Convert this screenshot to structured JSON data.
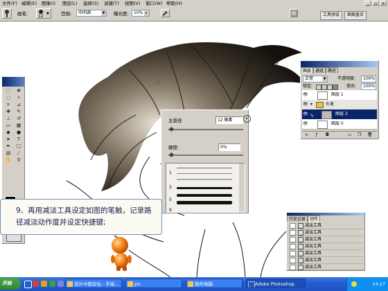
{
  "menubar": {
    "items": [
      "文件(F)",
      "编辑(E)",
      "图像(I)",
      "图层(L)",
      "选择(S)",
      "滤镜(T)",
      "视图(V)",
      "窗口(W)",
      "帮助(H)"
    ],
    "window_controls": [
      "_",
      "▫",
      "×"
    ]
  },
  "options": {
    "brush_label": "画笔:",
    "brush_size": "12",
    "range_label": "范围:",
    "range_value": "中间调",
    "exposure_label": "曝光度:",
    "exposure_value": "10%",
    "right_tabs": [
      "工具预设",
      "图案盖合"
    ]
  },
  "layers_panel": {
    "tabs": [
      "图层",
      "通道",
      "路径"
    ],
    "blend_mode": "正常",
    "opacity_label": "不透明度:",
    "opacity_value": "100%",
    "lock_label": "锁定:",
    "fill_label": "填充:",
    "fill_value": "100%",
    "layers": [
      {
        "name": "图层 1"
      },
      {
        "name": "头发"
      },
      {
        "name": "图层 3"
      },
      {
        "name": "图层 0"
      }
    ]
  },
  "brush_panel": {
    "diameter_label": "主直径",
    "diameter_value": "12 像素",
    "hardness_label": "硬度:",
    "hardness_value": "0%",
    "preset_numbers": [
      "1",
      "3",
      "5",
      "9"
    ]
  },
  "history_panel": {
    "tabs": [
      "历史记录",
      "动作"
    ],
    "items": [
      "减淡工具",
      "减淡工具",
      "减淡工具",
      "减淡工具",
      "减淡工具",
      "减淡工具",
      "减淡工具"
    ]
  },
  "callout": {
    "text": "9、再用减淡工具设定如图的笔触，记录路径减淡动作度并设定快捷键;"
  },
  "taskbar": {
    "start_label": "开始",
    "tasks": [
      {
        "label": "设计中国论坛 - 手绘..."
      },
      {
        "label": "pic"
      },
      {
        "label": "我的电脑"
      },
      {
        "label": "Adobe Photoshop"
      }
    ],
    "clock": "14:27"
  },
  "colors": {
    "toolbox_header": "#0a246a",
    "selected_layer": "#0a246a",
    "taskbar": "#245ed4",
    "start_button": "#2f8a2f"
  }
}
